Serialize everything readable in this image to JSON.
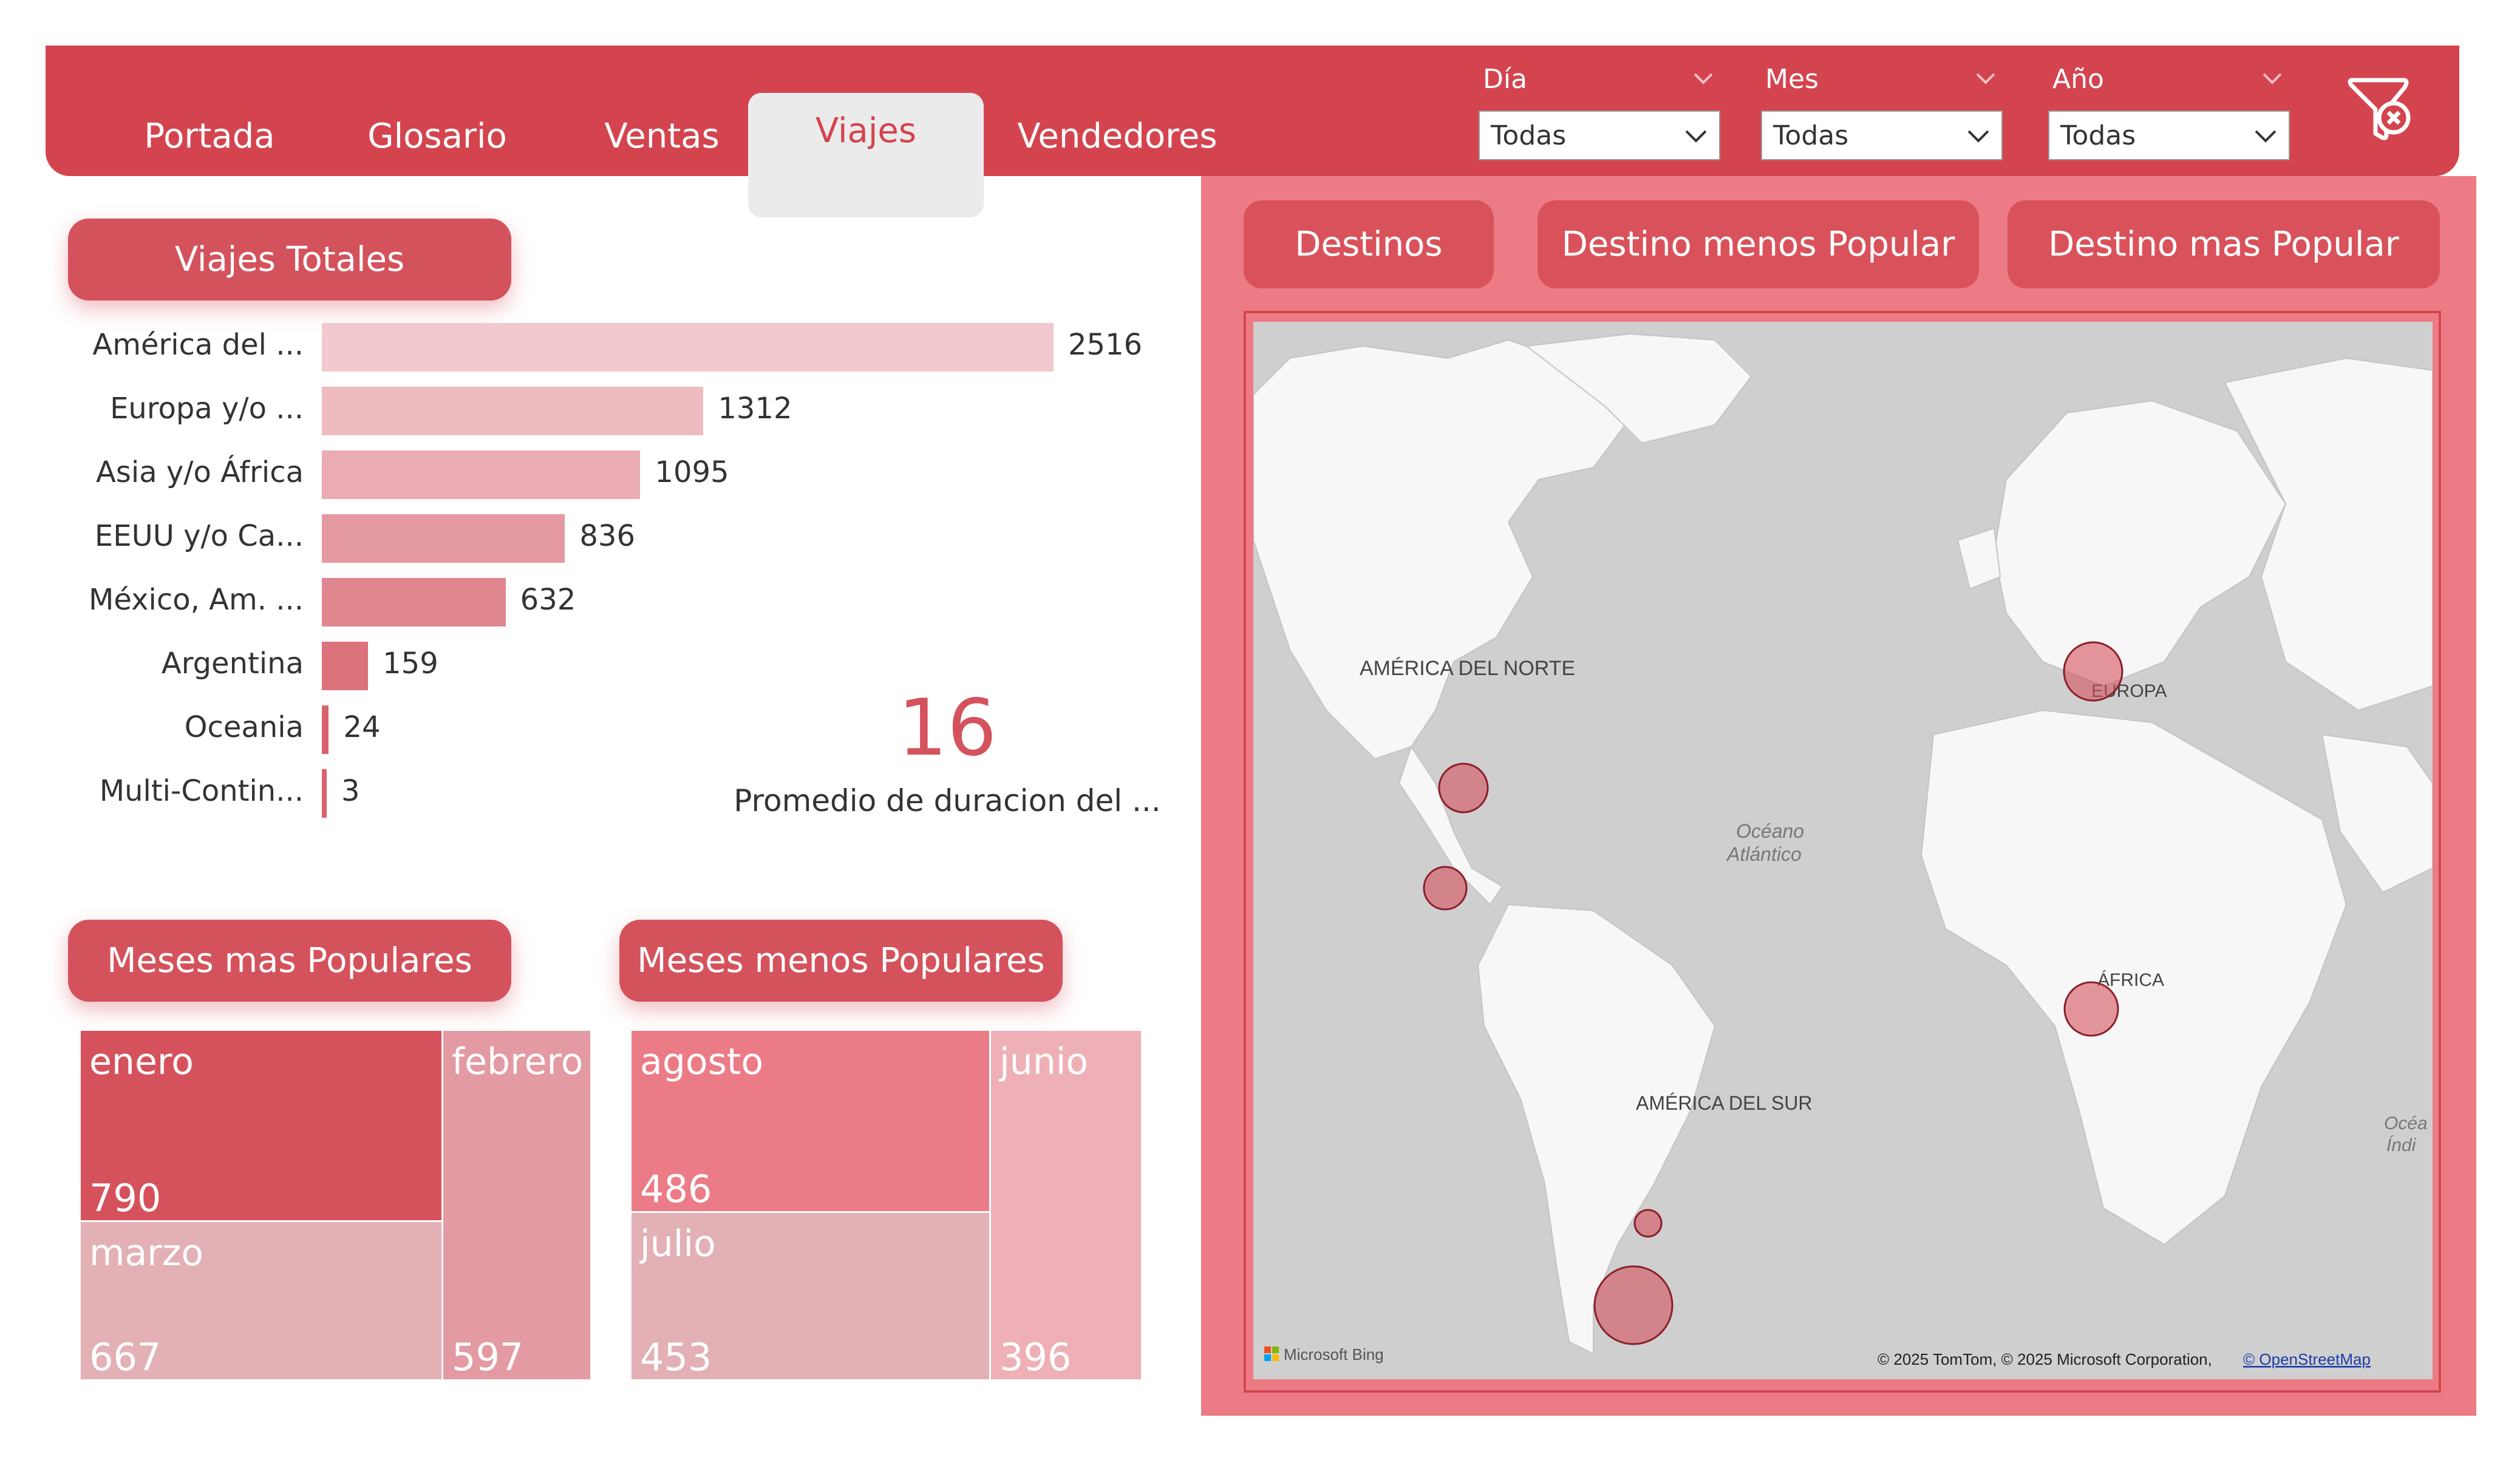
{
  "tabs": [
    "Portada",
    "Glosario",
    "Ventas",
    "Viajes",
    "Vendedores"
  ],
  "active_tab": "Viajes",
  "filters": [
    {
      "label": "Día",
      "value": "Todas"
    },
    {
      "label": "Mes",
      "value": "Todas"
    },
    {
      "label": "Año",
      "value": "Todas"
    }
  ],
  "clear_filters_icon": "filter-clear-icon",
  "viajes_totales": {
    "title": "Viajes Totales",
    "chart_data": {
      "type": "bar",
      "orientation": "horizontal",
      "categories": [
        "América del ...",
        "Europa y/o ...",
        "Asia y/o África",
        "EEUU y/o Ca...",
        "México, Am. ...",
        "Argentina",
        "Oceania",
        "Multi-Contin..."
      ],
      "values": [
        2516,
        1312,
        1095,
        836,
        632,
        159,
        24,
        3
      ],
      "colors": [
        "#f2c9ce",
        "#eebbc1",
        "#eaabb2",
        "#e59aa2",
        "#e08790",
        "#db727c",
        "#d8636e",
        "#d8636e"
      ]
    }
  },
  "kpi": {
    "value": "16",
    "label": "Promedio de duracion del ..."
  },
  "meses_mas": {
    "title": "Meses mas Populares",
    "chart_data": {
      "type": "treemap",
      "items": [
        {
          "name": "enero",
          "value": 790,
          "color": "#d5525d"
        },
        {
          "name": "marzo",
          "value": 667,
          "color": "#e2b0b5"
        },
        {
          "name": "febrero",
          "value": 597,
          "color": "#e39aa2"
        }
      ]
    }
  },
  "meses_menos": {
    "title": "Meses menos Populares",
    "chart_data": {
      "type": "treemap",
      "items": [
        {
          "name": "agosto",
          "value": 486,
          "color": "#eb7b86"
        },
        {
          "name": "julio",
          "value": 453,
          "color": "#e2b0b5"
        },
        {
          "name": "junio",
          "value": 396,
          "color": "#eeb0b6"
        }
      ]
    }
  },
  "map_buttons": [
    "Destinos",
    "Destino menos Popular",
    "Destino mas Popular"
  ],
  "map": {
    "labels": {
      "north_america": "AMÉRICA DEL NORTE",
      "europe": "EUROPA",
      "ocean_atlantic_1": "Océano",
      "ocean_atlantic_2": "Atlántico",
      "africa": "ÁFRICA",
      "south_america": "AMÉRICA DEL SUR",
      "ocean_indian_1": "Océa",
      "ocean_indian_2": "Índi"
    },
    "bing_logo": "Microsoft Bing",
    "copyright": "© 2025 TomTom, © 2025 Microsoft Corporation,",
    "osm_link": "© OpenStreetMap"
  }
}
